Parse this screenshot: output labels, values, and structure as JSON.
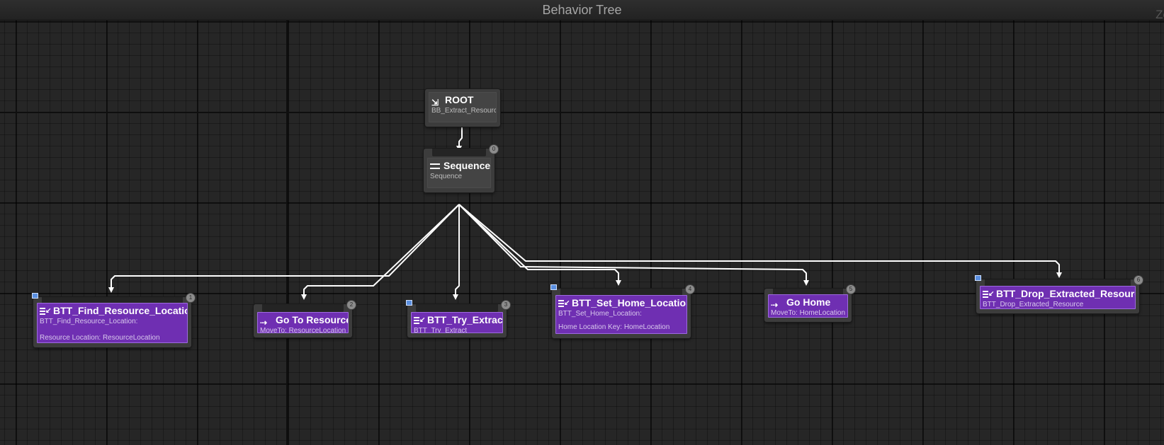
{
  "header": {
    "title": "Behavior Tree",
    "zoom_label": "Zo"
  },
  "icons": {
    "root": "root-icon",
    "composite": "sequence-icon",
    "task": "task-icon",
    "move": "move-to-icon",
    "breakpoint": "breakpoint-flag-icon"
  },
  "colors": {
    "task_body": "#6f2fb2",
    "composite_body": "#444444",
    "wire": "#ffffff",
    "grid_bg": "#262626"
  },
  "nodes": {
    "root": {
      "title": "ROOT",
      "subtitle": "BB_Extract_Resource"
    },
    "sequence": {
      "title": "Sequence",
      "subtitle": "Sequence",
      "index": "0"
    },
    "find_resource": {
      "title": "BTT_Find_Resource_Location",
      "subtitle": "BTT_Find_Resource_Location:",
      "detail": "Resource Location: ResourceLocation",
      "index": "1"
    },
    "go_to_resource": {
      "title": "Go To Resource",
      "subtitle": "MoveTo: ResourceLocation",
      "index": "2"
    },
    "try_extract": {
      "title": "BTT_Try_Extract",
      "subtitle": "BTT_Try_Extract",
      "index": "3"
    },
    "set_home": {
      "title": "BTT_Set_Home_Location",
      "subtitle": "BTT_Set_Home_Location:",
      "detail": "Home Location Key: HomeLocation",
      "index": "4"
    },
    "go_home": {
      "title": "Go Home",
      "subtitle": "MoveTo: HomeLocation",
      "index": "5"
    },
    "drop_resource": {
      "title": "BTT_Drop_Extracted_Resource",
      "subtitle": "BTT_Drop_Extracted_Resource",
      "index": "6"
    }
  }
}
